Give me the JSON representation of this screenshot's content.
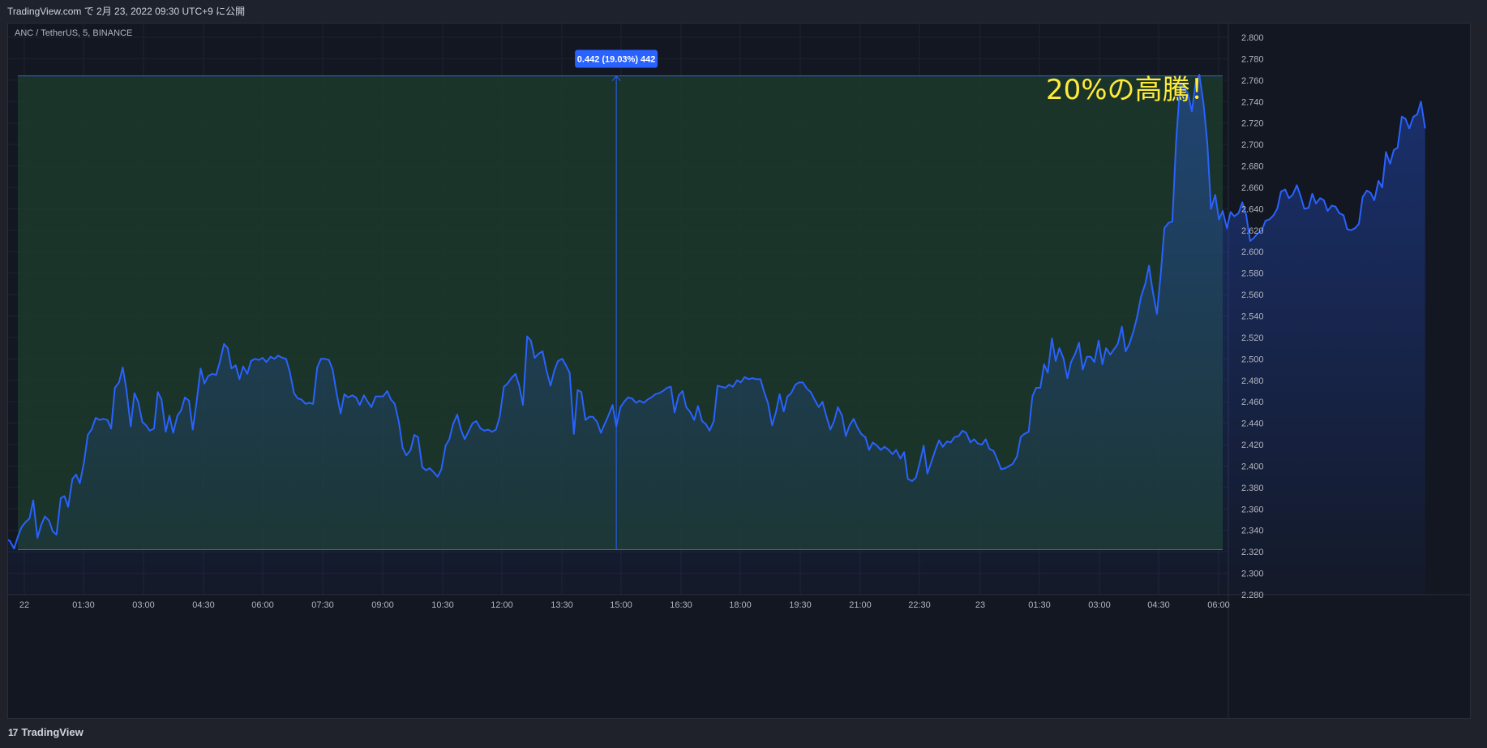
{
  "header": {
    "publish_text": "TradingView.com で 2月 23, 2022 09:30 UTC+9 に公開"
  },
  "symbol_label": "ANC / TetherUS, 5, BINANCE",
  "measure_label": "0.442 (19.03%) 442",
  "annotation": "20%の高騰！",
  "footer": {
    "logo_glyph": "17",
    "brand": "TradingView"
  },
  "colors": {
    "background": "#131722",
    "line": "#2962ff",
    "measure_fill": "#1d3a2a",
    "annotation": "#ffeb3b",
    "measure_label_bg": "#2962ff"
  },
  "chart_data": {
    "type": "area",
    "x_tick_labels": [
      "22",
      "01:30",
      "03:00",
      "04:30",
      "06:00",
      "07:30",
      "09:00",
      "10:30",
      "12:00",
      "13:30",
      "15:00",
      "16:30",
      "18:00",
      "19:30",
      "21:00",
      "22:30",
      "23",
      "01:30",
      "03:00",
      "04:30",
      "06:00"
    ],
    "y_tick_labels": [
      "2.800",
      "2.780",
      "2.760",
      "2.740",
      "2.720",
      "2.700",
      "2.680",
      "2.660",
      "2.640",
      "2.620",
      "2.600",
      "2.580",
      "2.560",
      "2.540",
      "2.520",
      "2.500",
      "2.480",
      "2.460",
      "2.440",
      "2.420",
      "2.400",
      "2.380",
      "2.360",
      "2.340",
      "2.320",
      "2.300",
      "2.280"
    ],
    "ylim": [
      2.28,
      2.8
    ],
    "x_hours_from_22_0000": [
      -0.33,
      -0.25,
      -0.17,
      -0.08,
      0.0,
      0.08,
      0.17,
      0.25,
      0.33,
      0.42,
      0.5,
      0.58,
      0.67,
      0.75,
      0.83,
      0.92,
      1.0,
      1.08,
      1.17,
      1.25,
      1.33,
      1.42,
      1.5,
      1.58,
      1.67,
      1.75,
      1.83,
      1.92,
      2.0,
      2.08,
      2.17,
      2.25,
      2.33,
      2.42,
      2.5,
      2.58,
      2.67,
      2.75,
      2.83,
      2.92,
      3.0,
      3.08,
      3.17,
      3.25,
      3.33,
      3.42,
      3.5,
      3.58,
      3.67,
      3.75,
      3.83,
      3.92,
      4.0,
      4.08,
      4.17,
      4.25,
      4.33,
      4.42,
      4.5,
      4.58,
      4.67,
      4.75,
      4.83,
      4.92,
      5.0,
      5.08,
      5.17,
      5.25,
      5.33,
      5.42,
      5.5,
      5.58,
      5.67,
      5.75,
      5.83,
      5.92,
      6.0,
      6.08,
      6.17,
      6.25,
      6.33,
      6.42,
      6.5,
      6.58,
      6.67,
      6.75,
      6.83,
      6.92,
      7.0,
      7.08,
      7.17,
      7.25,
      7.33,
      7.42,
      7.5,
      7.58,
      7.67,
      7.75,
      7.83,
      7.92,
      8.0,
      8.08,
      8.17,
      8.25,
      8.33,
      8.42,
      8.5,
      8.58,
      8.67,
      8.75,
      8.83,
      8.92,
      9.0,
      9.08,
      9.17,
      9.25,
      9.33,
      9.42,
      9.5,
      9.58,
      9.67,
      9.75,
      9.83,
      9.92,
      10.0,
      10.08,
      10.17,
      10.25,
      10.33,
      10.42,
      10.5,
      10.58,
      10.67,
      10.75,
      10.83,
      10.92,
      11.0,
      11.08,
      11.17,
      11.25,
      11.33,
      11.42,
      11.5,
      11.58,
      11.67,
      11.75,
      11.83,
      11.92,
      12.0,
      12.08,
      12.17,
      12.25,
      12.33,
      12.42,
      12.5,
      12.58,
      12.67,
      12.75,
      12.83,
      12.92,
      13.0,
      13.08,
      13.17,
      13.25,
      13.33,
      13.42,
      13.5,
      13.58,
      13.67,
      13.75,
      13.83,
      13.92,
      14.0,
      14.08,
      14.17,
      14.25,
      14.33,
      14.42,
      14.5,
      14.58,
      14.67,
      14.75,
      14.83,
      14.92,
      15.0,
      15.08,
      15.17,
      15.25,
      15.33,
      15.42,
      15.5,
      15.58,
      15.67,
      15.75,
      15.83,
      15.92,
      16.0,
      16.08,
      16.17,
      16.25,
      16.33,
      16.42,
      16.5,
      16.58,
      16.67,
      16.75,
      16.83,
      16.92,
      17.0,
      17.08,
      17.17,
      17.25,
      17.33,
      17.42,
      17.5,
      17.58,
      17.67,
      17.75,
      17.83,
      17.92,
      18.0,
      18.08,
      18.17,
      18.25,
      18.33,
      18.42,
      18.5,
      18.58,
      18.67,
      18.75,
      18.83,
      18.92,
      19.0,
      19.08,
      19.17,
      19.25,
      19.33,
      19.42,
      19.5,
      19.58,
      19.67,
      19.75,
      19.83,
      19.92,
      20.0,
      20.08,
      20.17,
      20.25,
      20.33,
      20.42,
      20.5,
      20.58,
      20.67,
      20.75,
      20.83,
      20.92,
      21.0,
      21.08,
      21.17,
      21.25,
      21.33,
      21.42,
      21.5,
      21.58,
      21.67,
      21.75,
      21.83,
      21.92,
      22.0,
      22.08,
      22.17,
      22.25,
      22.33,
      22.42,
      22.5,
      22.58,
      22.67,
      22.75,
      22.83,
      22.92,
      23.0,
      23.08,
      23.17,
      23.25,
      23.33,
      23.42,
      23.5,
      23.58,
      23.67,
      23.75,
      23.83,
      23.92,
      24.0,
      24.08,
      24.17,
      24.25,
      24.33,
      24.42,
      24.5,
      24.58,
      24.67,
      24.75,
      24.83,
      24.92,
      25.0,
      25.08,
      25.17,
      25.25,
      25.33,
      25.42,
      25.5,
      25.58,
      25.67,
      25.75,
      25.83,
      25.92,
      26.0,
      26.08,
      26.17,
      26.25,
      26.33,
      26.42,
      26.5,
      26.58,
      26.67,
      26.75,
      26.83,
      26.92,
      27.0,
      27.08,
      27.17,
      27.25,
      27.33,
      27.42,
      27.5,
      27.58,
      27.67,
      27.75,
      27.83,
      27.92,
      28.0,
      28.08,
      28.17,
      28.25,
      28.33,
      28.42,
      28.5,
      28.58,
      28.67,
      28.75,
      28.83,
      28.92,
      29.0,
      29.08,
      29.17,
      29.25,
      29.33,
      29.42,
      29.5,
      29.58,
      29.67,
      29.75,
      29.83,
      29.92,
      30.0,
      30.08,
      30.17,
      30.25
    ],
    "values": [
      2.331,
      2.332,
      2.33,
      2.323,
      2.334,
      2.343,
      2.348,
      2.351,
      2.368,
      2.333,
      2.345,
      2.353,
      2.349,
      2.339,
      2.336,
      2.37,
      2.372,
      2.362,
      2.388,
      2.392,
      2.384,
      2.404,
      2.429,
      2.434,
      2.445,
      2.443,
      2.444,
      2.443,
      2.435,
      2.473,
      2.478,
      2.492,
      2.471,
      2.437,
      2.468,
      2.46,
      2.441,
      2.438,
      2.433,
      2.435,
      2.469,
      2.462,
      2.432,
      2.447,
      2.431,
      2.447,
      2.452,
      2.464,
      2.461,
      2.434,
      2.459,
      2.491,
      2.477,
      2.484,
      2.486,
      2.485,
      2.497,
      2.514,
      2.51,
      2.491,
      2.494,
      2.481,
      2.493,
      2.486,
      2.498,
      2.5,
      2.499,
      2.501,
      2.497,
      2.502,
      2.5,
      2.503,
      2.501,
      2.5,
      2.488,
      2.468,
      2.463,
      2.462,
      2.458,
      2.459,
      2.458,
      2.492,
      2.5,
      2.5,
      2.499,
      2.49,
      2.469,
      2.449,
      2.467,
      2.464,
      2.466,
      2.464,
      2.457,
      2.466,
      2.46,
      2.455,
      2.465,
      2.465,
      2.465,
      2.47,
      2.462,
      2.458,
      2.441,
      2.417,
      2.41,
      2.415,
      2.429,
      2.427,
      2.399,
      2.396,
      2.398,
      2.394,
      2.39,
      2.397,
      2.419,
      2.425,
      2.439,
      2.448,
      2.434,
      2.425,
      2.433,
      2.44,
      2.442,
      2.435,
      2.433,
      2.434,
      2.432,
      2.434,
      2.446,
      2.474,
      2.477,
      2.482,
      2.486,
      2.475,
      2.457,
      2.521,
      2.517,
      2.501,
      2.505,
      2.507,
      2.49,
      2.475,
      2.489,
      2.498,
      2.5,
      2.494,
      2.487,
      2.43,
      2.471,
      2.469,
      2.443,
      2.446,
      2.446,
      2.441,
      2.431,
      2.439,
      2.448,
      2.457,
      2.437,
      2.455,
      2.46,
      2.464,
      2.463,
      2.459,
      2.461,
      2.459,
      2.462,
      2.464,
      2.467,
      2.468,
      2.47,
      2.473,
      2.474,
      2.45,
      2.466,
      2.47,
      2.455,
      2.45,
      2.443,
      2.456,
      2.442,
      2.439,
      2.433,
      2.442,
      2.475,
      2.474,
      2.473,
      2.476,
      2.474,
      2.48,
      2.478,
      2.483,
      2.481,
      2.482,
      2.481,
      2.481,
      2.469,
      2.459,
      2.438,
      2.45,
      2.467,
      2.451,
      2.465,
      2.468,
      2.476,
      2.478,
      2.478,
      2.472,
      2.469,
      2.462,
      2.455,
      2.46,
      2.447,
      2.434,
      2.442,
      2.455,
      2.447,
      2.428,
      2.438,
      2.444,
      2.436,
      2.43,
      2.427,
      2.415,
      2.422,
      2.419,
      2.415,
      2.418,
      2.415,
      2.411,
      2.415,
      2.407,
      2.413,
      2.388,
      2.386,
      2.389,
      2.402,
      2.419,
      2.393,
      2.403,
      2.415,
      2.424,
      2.418,
      2.423,
      2.422,
      2.427,
      2.428,
      2.433,
      2.431,
      2.422,
      2.425,
      2.421,
      2.42,
      2.425,
      2.416,
      2.414,
      2.406,
      2.397,
      2.398,
      2.4,
      2.402,
      2.409,
      2.427,
      2.43,
      2.432,
      2.465,
      2.473,
      2.473,
      2.495,
      2.487,
      2.519,
      2.498,
      2.51,
      2.5,
      2.482,
      2.497,
      2.505,
      2.515,
      2.49,
      2.502,
      2.502,
      2.497,
      2.517,
      2.495,
      2.51,
      2.504,
      2.509,
      2.514,
      2.53,
      2.507,
      2.514,
      2.526,
      2.54,
      2.558,
      2.57,
      2.587,
      2.563,
      2.542,
      2.578,
      2.622,
      2.627,
      2.628,
      2.702,
      2.757,
      2.753,
      2.748,
      2.731,
      2.757,
      2.765,
      2.738,
      2.702,
      2.64,
      2.653,
      2.63,
      2.638,
      2.622,
      2.637,
      2.633,
      2.636,
      2.646,
      2.635,
      2.61,
      2.613,
      2.617,
      2.62,
      2.629,
      2.63,
      2.634,
      2.64,
      2.656,
      2.658,
      2.65,
      2.653,
      2.662,
      2.652,
      2.64,
      2.641,
      2.654,
      2.645,
      2.65,
      2.648,
      2.638,
      2.643,
      2.642,
      2.636,
      2.634,
      2.621,
      2.62,
      2.622,
      2.626,
      2.651,
      2.657,
      2.655,
      2.648,
      2.666,
      2.66,
      2.693,
      2.682,
      2.695,
      2.697,
      2.726,
      2.724,
      2.715,
      2.726,
      2.728,
      2.74,
      2.715
    ],
    "measure": {
      "change": 0.442,
      "change_pct": 19.03,
      "ticks": 442,
      "low": 2.322,
      "high": 2.764,
      "x_start_hours": 0.0,
      "x_end_hours": 25.83,
      "x_marker_hours": 12.83
    },
    "grid": true,
    "legend": "none"
  }
}
